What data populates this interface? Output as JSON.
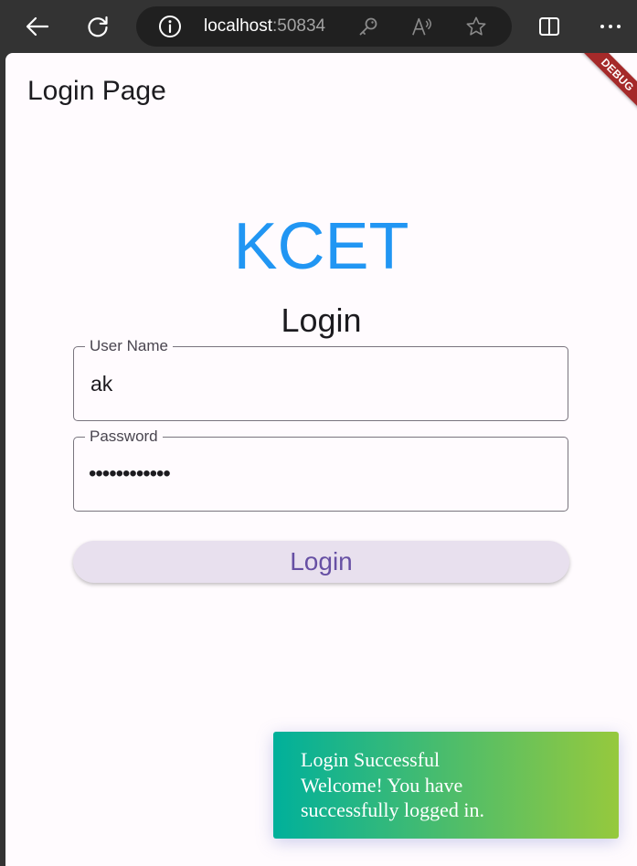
{
  "browser": {
    "host": "localhost",
    "port": ":50834",
    "icons": [
      "back-arrow-icon",
      "refresh-icon",
      "info-icon",
      "key-icon",
      "read-aloud-icon",
      "favorite-star-icon",
      "split-screen-icon",
      "more-icon"
    ]
  },
  "app": {
    "title": "Login Page",
    "debug_banner": "DEBUG",
    "brand": "KCET",
    "subtitle": "Login"
  },
  "form": {
    "username": {
      "label": "User Name",
      "value": "ak"
    },
    "password": {
      "label": "Password",
      "masked_value": "••••••••••••"
    },
    "submit_label": "Login"
  },
  "toast": {
    "title": "Login Successful",
    "message": "Welcome! You have successfully logged in."
  },
  "colors": {
    "brand": "#2196f3",
    "button_text": "#6750a4",
    "button_bg": "#e8e0ee",
    "toast_gradient_start": "#00b09b",
    "toast_gradient_end": "#96c93d",
    "debug_banner": "#a52a2a"
  }
}
